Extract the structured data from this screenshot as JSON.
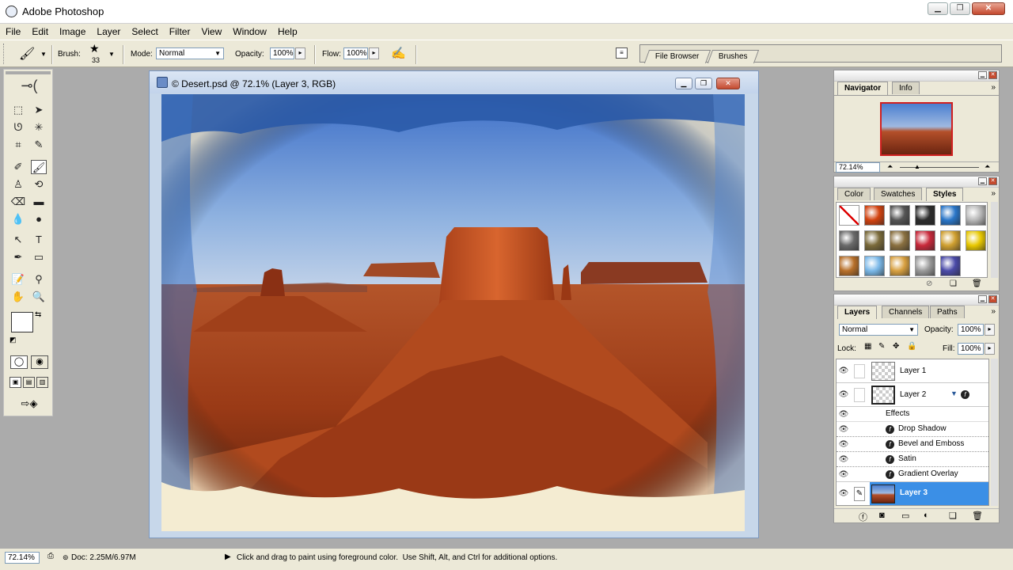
{
  "app": {
    "title": "Adobe Photoshop"
  },
  "menu": [
    "File",
    "Edit",
    "Image",
    "Layer",
    "Select",
    "Filter",
    "View",
    "Window",
    "Help"
  ],
  "options": {
    "brush_label": "Brush:",
    "brush_size": "33",
    "mode_label": "Mode:",
    "mode_value": "Normal",
    "opacity_label": "Opacity:",
    "opacity_value": "100%",
    "flow_label": "Flow:",
    "flow_value": "100%",
    "well_tabs": [
      "File Browser",
      "Brushes"
    ]
  },
  "document": {
    "title": "© Desert.psd @ 72.1% (Layer 3, RGB)"
  },
  "navigator": {
    "tabs": [
      "Navigator",
      "Info"
    ],
    "zoom": "72.14%"
  },
  "styles_panel": {
    "tabs": [
      "Color",
      "Swatches",
      "Styles"
    ],
    "swatch_colors": [
      "#ffffff",
      "#d2420f",
      "#555555",
      "#2c2c2c",
      "#2a76c8",
      "#b8b8b8",
      "#6a6a6a",
      "#7a6a3a",
      "#8a7040",
      "#c8283a",
      "#d0a030",
      "#e8c800",
      "#b8702a",
      "#7ab8e8",
      "#d8a040",
      "#9a9a9a",
      "#4a4aa8"
    ]
  },
  "layers_panel": {
    "tabs": [
      "Layers",
      "Channels",
      "Paths"
    ],
    "blend_mode": "Normal",
    "opacity_label": "Opacity:",
    "opacity_value": "100%",
    "lock_label": "Lock:",
    "fill_label": "Fill:",
    "fill_value": "100%",
    "layers": [
      {
        "name": "Layer 1"
      },
      {
        "name": "Layer 2"
      },
      {
        "name": "Layer 3"
      }
    ],
    "effects_label": "Effects",
    "effects": [
      "Drop Shadow",
      "Bevel and Emboss",
      "Satin",
      "Gradient Overlay"
    ]
  },
  "status": {
    "zoom": "72.14%",
    "doc_info": "Doc: 2.25M/6.97M",
    "hint": "Click and drag to paint using foreground color.  Use Shift, Alt, and Ctrl for additional options."
  }
}
